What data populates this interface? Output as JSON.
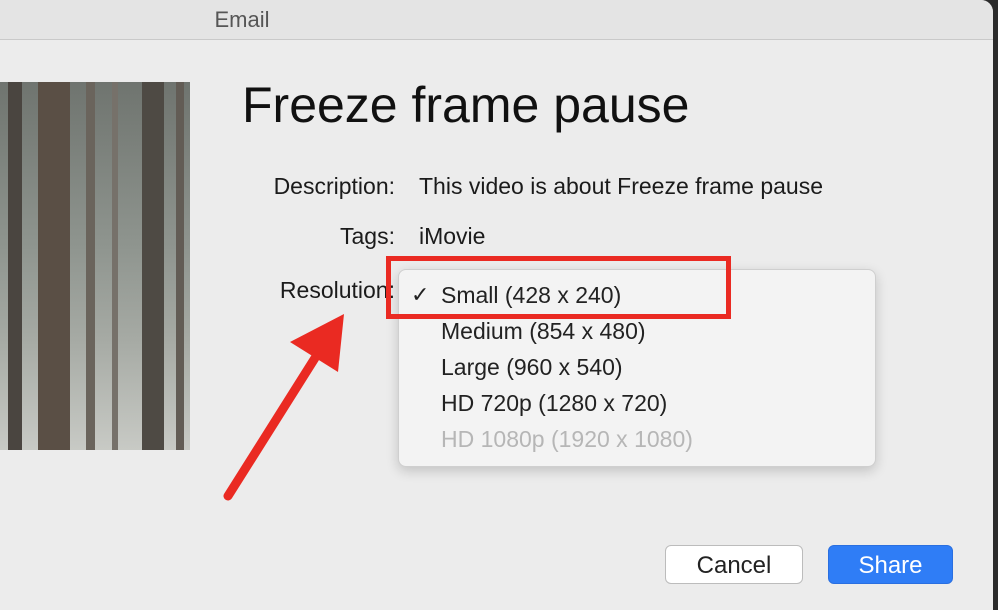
{
  "window": {
    "title": "Email"
  },
  "heading": "Freeze frame pause",
  "fields": {
    "description_label": "Description:",
    "description_value": "This video is about Freeze frame pause",
    "tags_label": "Tags:",
    "tags_value": "iMovie",
    "resolution_label": "Resolution:"
  },
  "resolution_menu": {
    "selected_index": 0,
    "items": [
      {
        "label": "Small (428 x 240)",
        "enabled": true,
        "selected": true
      },
      {
        "label": "Medium (854 x 480)",
        "enabled": true,
        "selected": false
      },
      {
        "label": "Large (960 x 540)",
        "enabled": true,
        "selected": false
      },
      {
        "label": "HD 720p (1280 x 720)",
        "enabled": true,
        "selected": false
      },
      {
        "label": "HD 1080p (1920 x 1080)",
        "enabled": false,
        "selected": false
      }
    ]
  },
  "buttons": {
    "cancel": "Cancel",
    "share": "Share"
  },
  "colors": {
    "accent": "#2f7df6",
    "annotation": "#ea2a22"
  }
}
